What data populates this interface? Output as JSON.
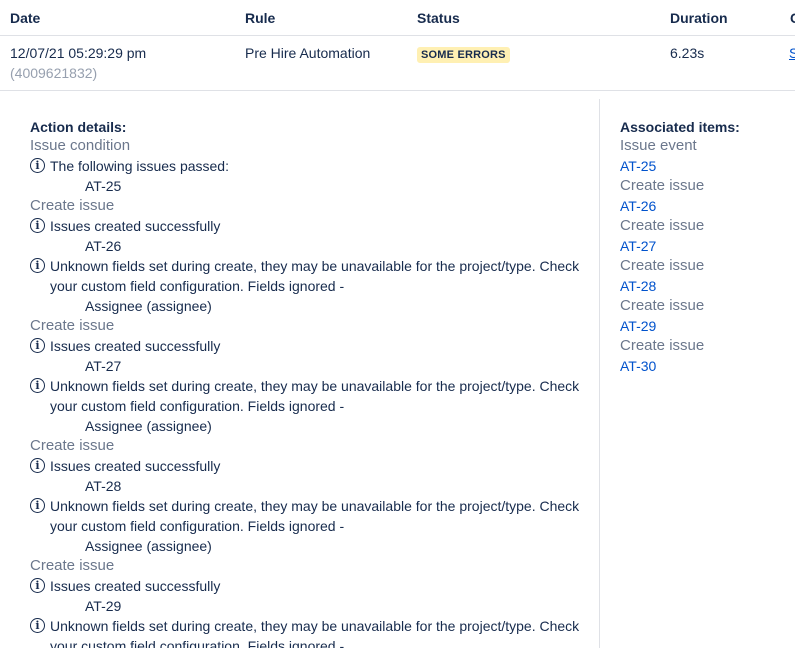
{
  "table": {
    "headers": [
      "Date",
      "Rule",
      "Status",
      "Duration",
      "C"
    ],
    "row": {
      "date": "12/07/21 05:29:29 pm",
      "id": "(4009621832)",
      "rule": "Pre Hire Automation",
      "status": "SOME ERRORS",
      "duration": "6.23s",
      "cut_link": "S"
    }
  },
  "action_details": {
    "title": "Action details:",
    "condition_title": "Issue condition",
    "condition_msg": "The following issues passed:",
    "condition_issue": "AT-25",
    "blocks": [
      {
        "title": "Create issue",
        "success": "Issues created successfully",
        "issue": "AT-26",
        "warn1": "Unknown fields set during create, they may be unavailable for the project/type. Check",
        "warn2": "your custom field configuration. Fields ignored -",
        "field": "Assignee (assignee)"
      },
      {
        "title": "Create issue",
        "success": "Issues created successfully",
        "issue": "AT-27",
        "warn1": "Unknown fields set during create, they may be unavailable for the project/type. Check",
        "warn2": "your custom field configuration. Fields ignored -",
        "field": "Assignee (assignee)"
      },
      {
        "title": "Create issue",
        "success": "Issues created successfully",
        "issue": "AT-28",
        "warn1": "Unknown fields set during create, they may be unavailable for the project/type. Check",
        "warn2": "your custom field configuration. Fields ignored -",
        "field": "Assignee (assignee)"
      },
      {
        "title": "Create issue",
        "success": "Issues created successfully",
        "issue": "AT-29",
        "warn1": "Unknown fields set during create, they may be unavailable for the project/type. Check",
        "warn2": "your custom field configuration. Fields ignored -"
      }
    ]
  },
  "associated": {
    "title": "Associated items:",
    "items": [
      {
        "label": "Issue event",
        "key": "AT-25"
      },
      {
        "label": "Create issue",
        "key": "AT-26"
      },
      {
        "label": "Create issue",
        "key": "AT-27"
      },
      {
        "label": "Create issue",
        "key": "AT-28"
      },
      {
        "label": "Create issue",
        "key": "AT-29"
      },
      {
        "label": "Create issue",
        "key": "AT-30"
      }
    ]
  },
  "colors": {
    "link": "#0052cc",
    "badge_bg": "#fff0b3",
    "muted": "#6b778c",
    "text": "#172b4d"
  },
  "icons": {
    "info": "info-circle-icon"
  }
}
